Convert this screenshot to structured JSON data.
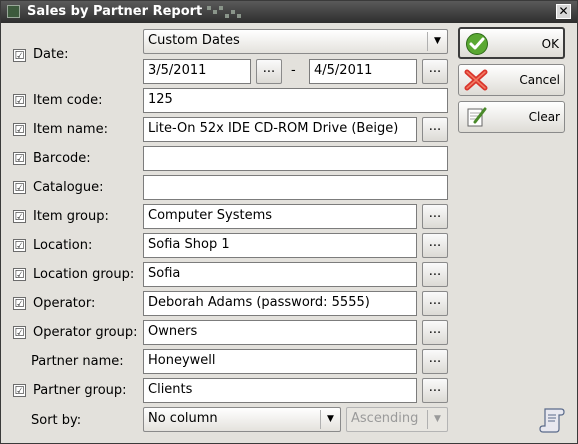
{
  "window": {
    "title": "Sales by Partner Report",
    "close_glyph": "✕"
  },
  "check_glyph": "☑",
  "form": {
    "date": {
      "label": "Date:",
      "checked": true,
      "mode": "Custom Dates",
      "from": "3/5/2011",
      "separator": "-",
      "to": "4/5/2011"
    },
    "item_code": {
      "label": "Item code:",
      "checked": true,
      "value": "125"
    },
    "item_name": {
      "label": "Item name:",
      "checked": true,
      "value": "Lite-On 52x IDE CD-ROM Drive (Beige)"
    },
    "barcode": {
      "label": "Barcode:",
      "checked": true,
      "value": ""
    },
    "catalogue": {
      "label": "Catalogue:",
      "checked": true,
      "value": ""
    },
    "item_group": {
      "label": "Item group:",
      "checked": true,
      "value": "Computer Systems"
    },
    "location": {
      "label": "Location:",
      "checked": true,
      "value": "Sofia Shop 1"
    },
    "location_group": {
      "label": "Location group:",
      "checked": true,
      "value": "Sofia"
    },
    "operator": {
      "label": "Operator:",
      "checked": true,
      "value": "Deborah Adams (password: 5555)"
    },
    "operator_group": {
      "label": "Operator group:",
      "checked": true,
      "value": "Owners"
    },
    "partner_name": {
      "label": "Partner name:",
      "checked": false,
      "value": "Honeywell"
    },
    "partner_group": {
      "label": "Partner group:",
      "checked": true,
      "value": "Clients"
    },
    "sort_by": {
      "label": "Sort by:",
      "column": "No column",
      "direction": "Ascending"
    },
    "browse_label": "..."
  },
  "buttons": {
    "ok": "OK",
    "cancel": "Cancel",
    "clear": "Clear"
  },
  "icons": {
    "ok": "check-circle-icon",
    "cancel": "red-x-icon",
    "clear": "eraser-icon",
    "help": "scroll-icon"
  },
  "colors": {
    "title_bar": "#3a3a3a",
    "ok_green": "#5aa832",
    "cancel_red": "#d9342b"
  }
}
